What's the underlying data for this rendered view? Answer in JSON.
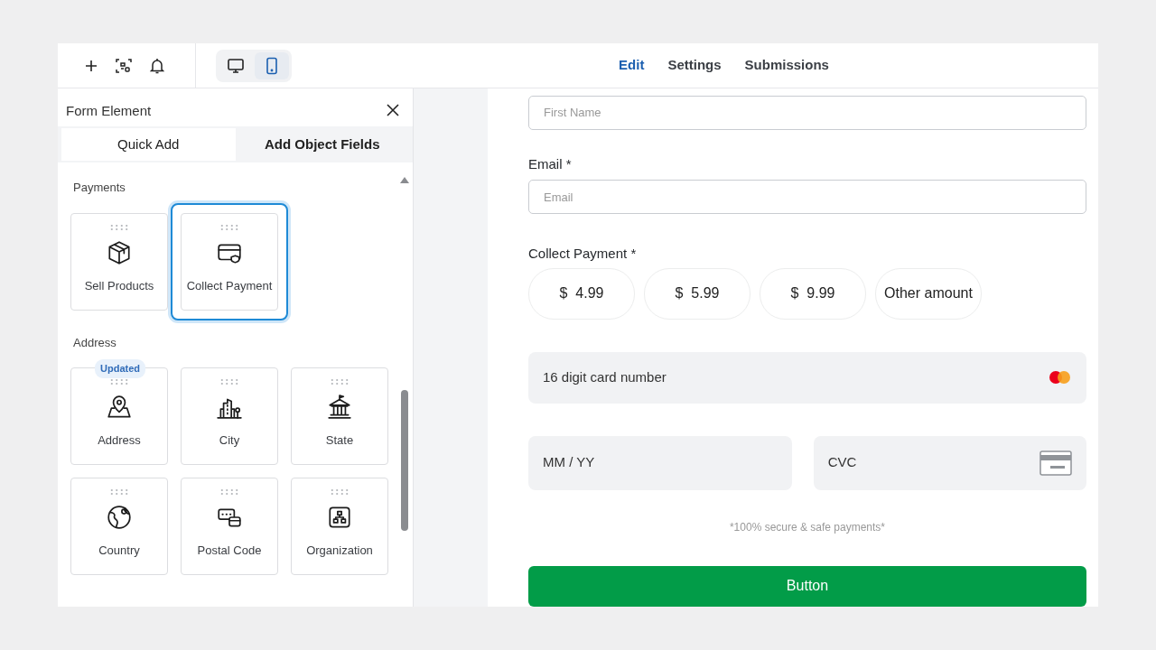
{
  "toolbar": {
    "devices": [
      {
        "kind": "desktop",
        "selected": false
      },
      {
        "kind": "mobile",
        "selected": true
      }
    ]
  },
  "nav": {
    "tabs": [
      {
        "label": "Edit",
        "selected": true
      },
      {
        "label": "Settings",
        "selected": false
      },
      {
        "label": "Submissions",
        "selected": false
      }
    ]
  },
  "panel": {
    "title": "Form Element",
    "tabs": [
      {
        "label": "Quick Add",
        "selected": true
      },
      {
        "label": "Add Object Fields",
        "selected": false
      }
    ],
    "sections": [
      {
        "title": "Payments",
        "items": [
          {
            "label": "Sell Products",
            "kind": "box",
            "selected": false
          },
          {
            "label": "Collect Payment",
            "kind": "card",
            "selected": true
          }
        ]
      },
      {
        "title": "Address",
        "items": [
          {
            "label": "Address",
            "kind": "pin",
            "selected": false,
            "badge": "Updated"
          },
          {
            "label": "City",
            "kind": "city",
            "selected": false
          },
          {
            "label": "State",
            "kind": "state",
            "selected": false
          },
          {
            "label": "Country",
            "kind": "globe",
            "selected": false
          },
          {
            "label": "Postal Code",
            "kind": "postal",
            "selected": false
          },
          {
            "label": "Organization",
            "kind": "org",
            "selected": false
          }
        ]
      }
    ]
  },
  "form": {
    "fields": [
      {
        "placeholder": "First Name"
      },
      {
        "label": "Email *",
        "placeholder": "Email"
      }
    ],
    "payment": {
      "label": "Collect Payment *",
      "amounts": [
        {
          "label": "$  4.99",
          "selected": false
        },
        {
          "label": "$  5.99",
          "selected": false
        },
        {
          "label": "$  9.99",
          "selected": false
        },
        {
          "label": "Other amount",
          "selected": false
        }
      ],
      "card_number": "16 digit card number",
      "expiry": "MM / YY",
      "cvc": "CVC",
      "note": "*100% secure & safe payments*"
    },
    "submit": "Button"
  }
}
